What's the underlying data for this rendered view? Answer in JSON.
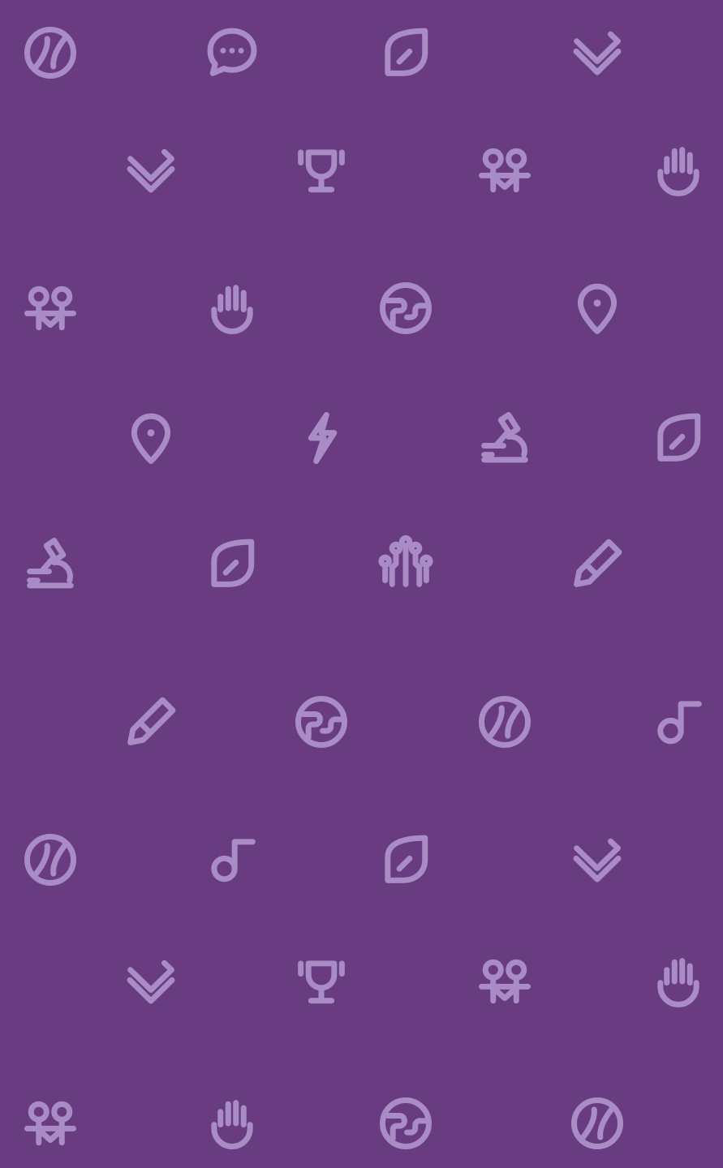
{
  "background_color": "#693b80",
  "icon_color": "#a98bc5",
  "rows": [
    [
      "tennis-ball-icon",
      "chat-bubble-icon",
      "leaf-icon",
      "heart-chevron-icon"
    ],
    [
      "heart-chevron-icon",
      "trophy-icon",
      "people-icon",
      "hand-icon"
    ],
    [
      "people-icon",
      "hand-icon",
      "globe-icon",
      "location-pin-icon"
    ],
    [
      "location-pin-icon",
      "lightning-icon",
      "microscope-icon",
      "leaf-icon"
    ],
    [
      "microscope-icon",
      "leaf-icon",
      "circuit-icon",
      "pencil-icon"
    ],
    [
      "pencil-icon",
      "globe-icon",
      "tennis-ball-icon",
      "music-note-icon"
    ],
    [
      "tennis-ball-icon",
      "music-note-icon",
      "leaf-icon",
      "heart-chevron-icon"
    ],
    [
      "heart-chevron-icon",
      "trophy-icon",
      "people-icon",
      "hand-icon"
    ],
    [
      "people-icon",
      "hand-icon",
      "globe-icon",
      "tennis-ball-icon"
    ]
  ]
}
